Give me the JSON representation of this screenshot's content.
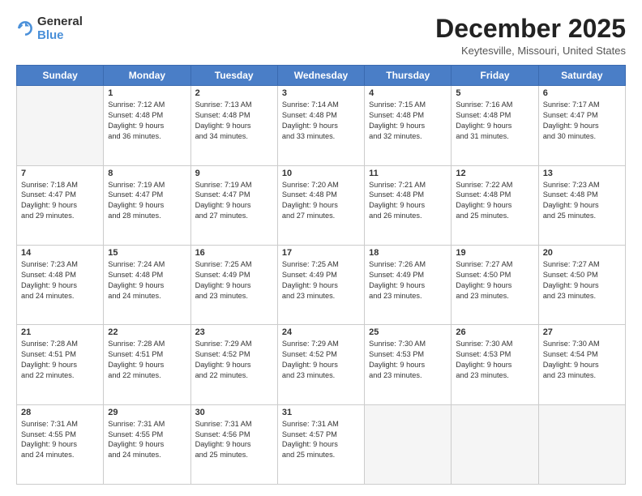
{
  "header": {
    "logo_general": "General",
    "logo_blue": "Blue",
    "month_title": "December 2025",
    "location": "Keytesville, Missouri, United States"
  },
  "days_of_week": [
    "Sunday",
    "Monday",
    "Tuesday",
    "Wednesday",
    "Thursday",
    "Friday",
    "Saturday"
  ],
  "weeks": [
    [
      {
        "day": "",
        "info": ""
      },
      {
        "day": "1",
        "info": "Sunrise: 7:12 AM\nSunset: 4:48 PM\nDaylight: 9 hours\nand 36 minutes."
      },
      {
        "day": "2",
        "info": "Sunrise: 7:13 AM\nSunset: 4:48 PM\nDaylight: 9 hours\nand 34 minutes."
      },
      {
        "day": "3",
        "info": "Sunrise: 7:14 AM\nSunset: 4:48 PM\nDaylight: 9 hours\nand 33 minutes."
      },
      {
        "day": "4",
        "info": "Sunrise: 7:15 AM\nSunset: 4:48 PM\nDaylight: 9 hours\nand 32 minutes."
      },
      {
        "day": "5",
        "info": "Sunrise: 7:16 AM\nSunset: 4:48 PM\nDaylight: 9 hours\nand 31 minutes."
      },
      {
        "day": "6",
        "info": "Sunrise: 7:17 AM\nSunset: 4:47 PM\nDaylight: 9 hours\nand 30 minutes."
      }
    ],
    [
      {
        "day": "7",
        "info": "Sunrise: 7:18 AM\nSunset: 4:47 PM\nDaylight: 9 hours\nand 29 minutes."
      },
      {
        "day": "8",
        "info": "Sunrise: 7:19 AM\nSunset: 4:47 PM\nDaylight: 9 hours\nand 28 minutes."
      },
      {
        "day": "9",
        "info": "Sunrise: 7:19 AM\nSunset: 4:47 PM\nDaylight: 9 hours\nand 27 minutes."
      },
      {
        "day": "10",
        "info": "Sunrise: 7:20 AM\nSunset: 4:48 PM\nDaylight: 9 hours\nand 27 minutes."
      },
      {
        "day": "11",
        "info": "Sunrise: 7:21 AM\nSunset: 4:48 PM\nDaylight: 9 hours\nand 26 minutes."
      },
      {
        "day": "12",
        "info": "Sunrise: 7:22 AM\nSunset: 4:48 PM\nDaylight: 9 hours\nand 25 minutes."
      },
      {
        "day": "13",
        "info": "Sunrise: 7:23 AM\nSunset: 4:48 PM\nDaylight: 9 hours\nand 25 minutes."
      }
    ],
    [
      {
        "day": "14",
        "info": "Sunrise: 7:23 AM\nSunset: 4:48 PM\nDaylight: 9 hours\nand 24 minutes."
      },
      {
        "day": "15",
        "info": "Sunrise: 7:24 AM\nSunset: 4:48 PM\nDaylight: 9 hours\nand 24 minutes."
      },
      {
        "day": "16",
        "info": "Sunrise: 7:25 AM\nSunset: 4:49 PM\nDaylight: 9 hours\nand 23 minutes."
      },
      {
        "day": "17",
        "info": "Sunrise: 7:25 AM\nSunset: 4:49 PM\nDaylight: 9 hours\nand 23 minutes."
      },
      {
        "day": "18",
        "info": "Sunrise: 7:26 AM\nSunset: 4:49 PM\nDaylight: 9 hours\nand 23 minutes."
      },
      {
        "day": "19",
        "info": "Sunrise: 7:27 AM\nSunset: 4:50 PM\nDaylight: 9 hours\nand 23 minutes."
      },
      {
        "day": "20",
        "info": "Sunrise: 7:27 AM\nSunset: 4:50 PM\nDaylight: 9 hours\nand 23 minutes."
      }
    ],
    [
      {
        "day": "21",
        "info": "Sunrise: 7:28 AM\nSunset: 4:51 PM\nDaylight: 9 hours\nand 22 minutes."
      },
      {
        "day": "22",
        "info": "Sunrise: 7:28 AM\nSunset: 4:51 PM\nDaylight: 9 hours\nand 22 minutes."
      },
      {
        "day": "23",
        "info": "Sunrise: 7:29 AM\nSunset: 4:52 PM\nDaylight: 9 hours\nand 22 minutes."
      },
      {
        "day": "24",
        "info": "Sunrise: 7:29 AM\nSunset: 4:52 PM\nDaylight: 9 hours\nand 23 minutes."
      },
      {
        "day": "25",
        "info": "Sunrise: 7:30 AM\nSunset: 4:53 PM\nDaylight: 9 hours\nand 23 minutes."
      },
      {
        "day": "26",
        "info": "Sunrise: 7:30 AM\nSunset: 4:53 PM\nDaylight: 9 hours\nand 23 minutes."
      },
      {
        "day": "27",
        "info": "Sunrise: 7:30 AM\nSunset: 4:54 PM\nDaylight: 9 hours\nand 23 minutes."
      }
    ],
    [
      {
        "day": "28",
        "info": "Sunrise: 7:31 AM\nSunset: 4:55 PM\nDaylight: 9 hours\nand 24 minutes."
      },
      {
        "day": "29",
        "info": "Sunrise: 7:31 AM\nSunset: 4:55 PM\nDaylight: 9 hours\nand 24 minutes."
      },
      {
        "day": "30",
        "info": "Sunrise: 7:31 AM\nSunset: 4:56 PM\nDaylight: 9 hours\nand 25 minutes."
      },
      {
        "day": "31",
        "info": "Sunrise: 7:31 AM\nSunset: 4:57 PM\nDaylight: 9 hours\nand 25 minutes."
      },
      {
        "day": "",
        "info": ""
      },
      {
        "day": "",
        "info": ""
      },
      {
        "day": "",
        "info": ""
      }
    ]
  ]
}
